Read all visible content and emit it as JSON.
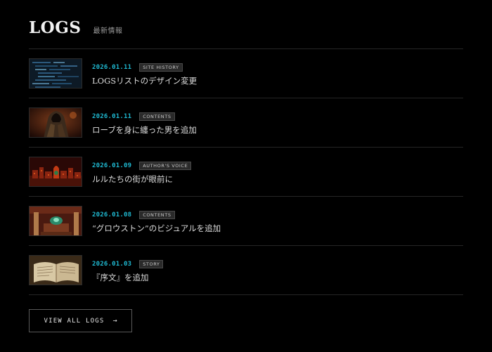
{
  "header": {
    "title": "LOGS",
    "subtitle": "最新情報"
  },
  "logs": [
    {
      "date": "2026.01.11",
      "tag": "SITE HISTORY",
      "title": "LOGSリストのデザイン変更",
      "thumbnail": "code-screen"
    },
    {
      "date": "2026.01.11",
      "tag": "CONTENTS",
      "title": "ローブを身に纏った男を追加",
      "thumbnail": "robed-man"
    },
    {
      "date": "2026.01.09",
      "tag": "AUTHOR'S VOICE",
      "title": "ルルたちの街が眼前に",
      "thumbnail": "red-city"
    },
    {
      "date": "2026.01.08",
      "tag": "CONTENTS",
      "title": "“グロウストン”のビジュアルを追加",
      "thumbnail": "glowstone-shrine"
    },
    {
      "date": "2026.01.03",
      "tag": "STORY",
      "title": "『序文』を追加",
      "thumbnail": "open-book"
    }
  ],
  "view_all": {
    "label": "VIEW ALL LOGS",
    "arrow": "→"
  }
}
